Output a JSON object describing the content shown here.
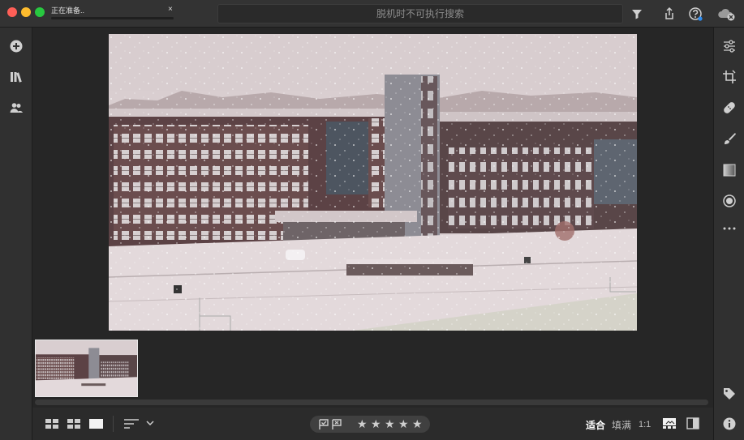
{
  "window": {
    "task_label": "正在准备..",
    "task_close": "×"
  },
  "search": {
    "placeholder": "脱机时不可执行搜索"
  },
  "bottom": {
    "zoom_fit": "适合",
    "zoom_fill": "填满",
    "zoom_one": "1:1"
  },
  "rating": {
    "stars": [
      "★",
      "★",
      "★",
      "★",
      "★"
    ]
  },
  "colors": {
    "accent_blue": "#2d8cf0",
    "background": "#262626",
    "panel": "#303030"
  },
  "icons": {
    "left": [
      "add-icon",
      "library-icon",
      "people-icon"
    ],
    "right": [
      "edit-sliders-icon",
      "crop-icon",
      "healing-icon",
      "brush-icon",
      "linear-gradient-icon",
      "radial-gradient-icon",
      "more-icon",
      "tag-icon",
      "info-icon"
    ],
    "top": [
      "filter-icon",
      "share-icon",
      "help-icon",
      "cloud-icon"
    ]
  }
}
